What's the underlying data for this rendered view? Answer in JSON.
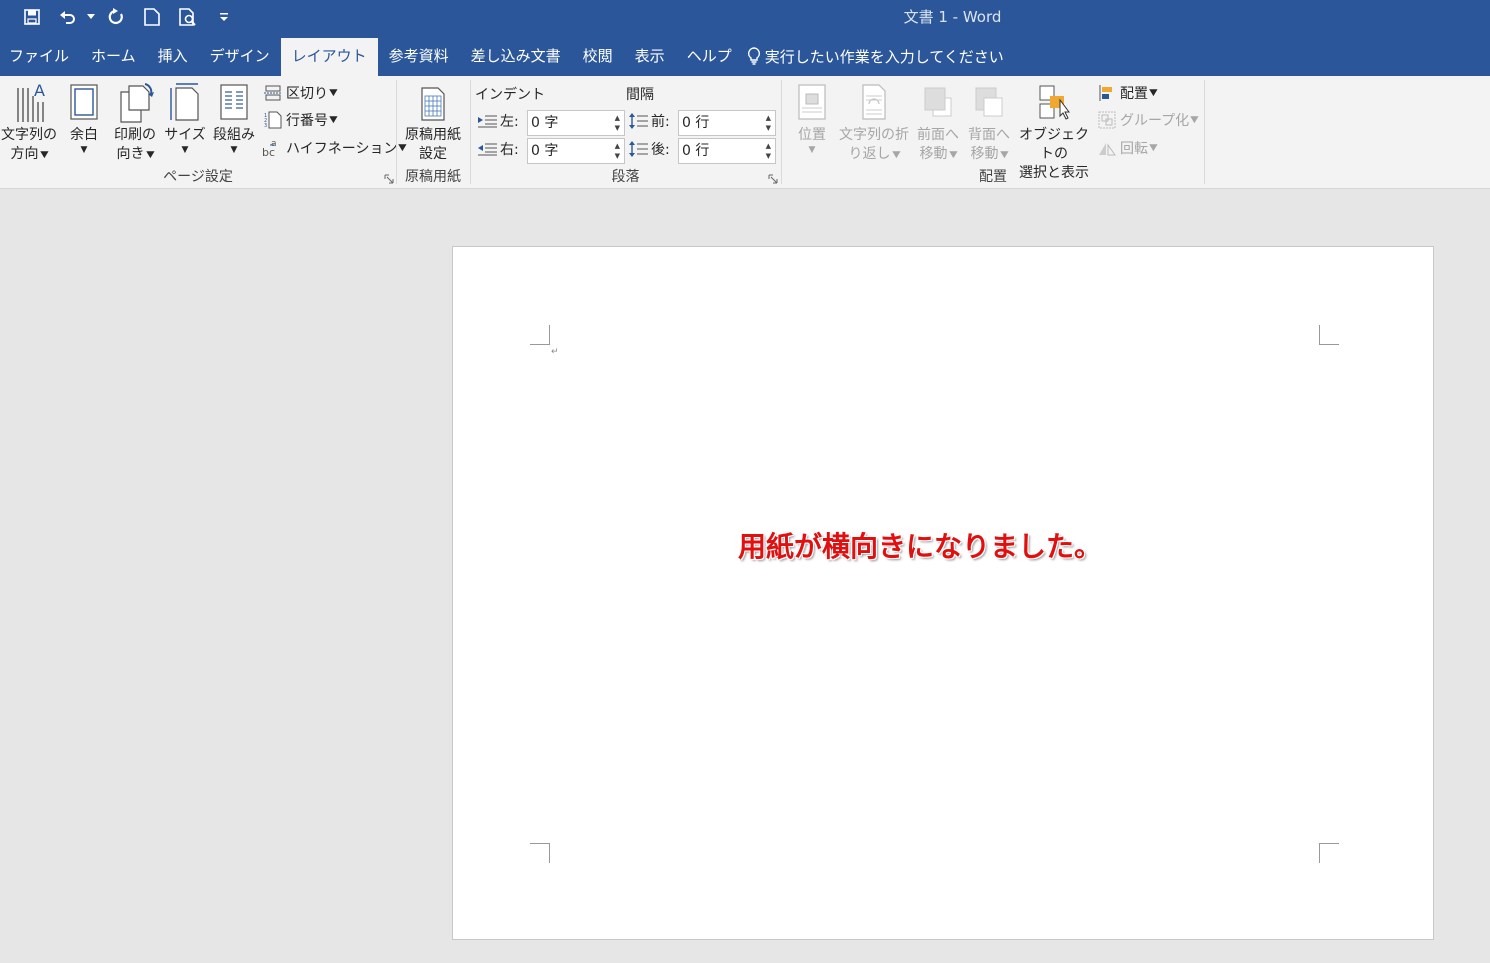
{
  "window": {
    "title": "文書 1  -  Word"
  },
  "qat": {
    "icons": [
      "save-icon",
      "undo-icon",
      "redo-icon",
      "new-document-icon",
      "print-preview-icon",
      "customize-icon"
    ]
  },
  "tabs": [
    "ファイル",
    "ホーム",
    "挿入",
    "デザイン",
    "レイアウト",
    "参考資料",
    "差し込み文書",
    "校閲",
    "表示",
    "ヘルプ"
  ],
  "active_tab": "レイアウト",
  "tell_me": "実行したい作業を入力してください",
  "ribbon": {
    "page_setup": {
      "label": "ページ設定",
      "text_direction": [
        "文字列の",
        "方向"
      ],
      "margins": "余白",
      "orientation": [
        "印刷の",
        "向き"
      ],
      "size": "サイズ",
      "columns": "段組み",
      "breaks": "区切り",
      "line_numbers": "行番号",
      "hyphenation": "ハイフネーション"
    },
    "genko": {
      "label": "原稿用紙",
      "button": [
        "原稿用紙",
        "設定"
      ]
    },
    "paragraph": {
      "label": "段落",
      "indent_title": "インデント",
      "spacing_title": "間隔",
      "indent_left_label": "左:",
      "indent_left_value": "0 字",
      "indent_right_label": "右:",
      "indent_right_value": "0 字",
      "spacing_before_label": "前:",
      "spacing_before_value": "0 行",
      "spacing_after_label": "後:",
      "spacing_after_value": "0 行"
    },
    "arrange": {
      "label": "配置",
      "position": "位置",
      "wrap_text": [
        "文字列の折",
        "り返し"
      ],
      "bring_forward": [
        "前面へ",
        "移動"
      ],
      "send_backward": [
        "背面へ",
        "移動"
      ],
      "selection_pane": [
        "オブジェクトの",
        "選択と表示"
      ],
      "align": "配置",
      "group": "グループ化",
      "rotate": "回転"
    }
  },
  "document": {
    "message": "用紙が横向きになりました。",
    "paragraph_mark": "↵"
  },
  "colors": {
    "titlebar": "#2b579a",
    "ribbon": "#f3f3f3",
    "message": "#e01010"
  }
}
